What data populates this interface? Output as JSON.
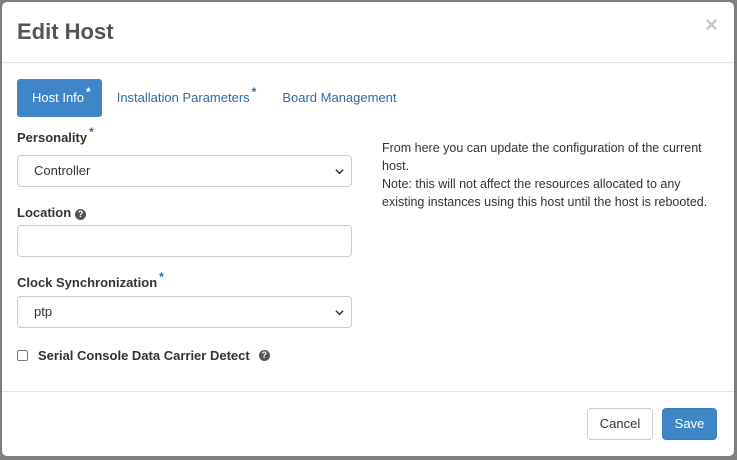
{
  "modal": {
    "title": "Edit Host",
    "close_glyph": "×"
  },
  "tabs": [
    {
      "label": "Host Info",
      "required": "*",
      "active": true
    },
    {
      "label": "Installation Parameters",
      "required": "*",
      "active": false
    },
    {
      "label": "Board Management",
      "active": false
    }
  ],
  "form": {
    "personality": {
      "label": "Personality",
      "required": "*",
      "value": "Controller"
    },
    "location": {
      "label": "Location",
      "value": "",
      "help_icon": "question-circle-icon"
    },
    "clock_sync": {
      "label": "Clock Synchronization",
      "required": "*",
      "value": "ptp"
    },
    "serial_console": {
      "label": "Serial Console Data Carrier Detect",
      "checked": false,
      "help_icon": "question-circle-icon"
    }
  },
  "help_text": {
    "line1": "From here you can update the configuration of the current host.",
    "line2": "Note: this will not affect the resources allocated to any existing instances using this host until the host is rebooted."
  },
  "footer": {
    "cancel_label": "Cancel",
    "save_label": "Save"
  },
  "colors": {
    "primary": "#3f86c8",
    "link": "#2e6da4",
    "backdrop": "#7f7f7f"
  }
}
